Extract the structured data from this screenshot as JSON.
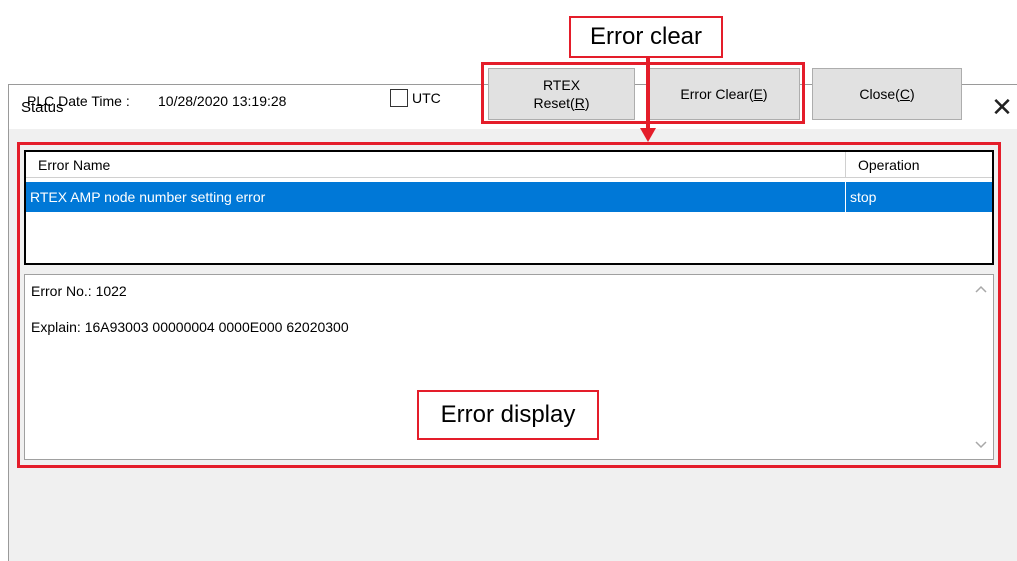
{
  "window": {
    "title": "Status",
    "close_glyph": "✕"
  },
  "plc": {
    "label": "PLC Date Time :",
    "value": "10/28/2020 13:19:28"
  },
  "utc": {
    "label": "UTC",
    "checked": false
  },
  "buttons": {
    "rtex_reset": {
      "line1": "RTEX",
      "line2_prefix": "Reset(",
      "accelerator": "R",
      "line2_suffix": ")"
    },
    "error_clear": {
      "prefix": "Error Clear(",
      "accelerator": "E",
      "suffix": ")"
    },
    "close": {
      "prefix": "Close(",
      "accelerator": "C",
      "suffix": ")"
    }
  },
  "error_table": {
    "columns": [
      "Error Name",
      "Operation"
    ],
    "rows": [
      {
        "name": "RTEX AMP node number setting error",
        "operation": "stop",
        "selected": true
      }
    ]
  },
  "detail": {
    "error_no_label": "Error No.:",
    "error_no_value": "1022",
    "explain_label": "Explain:",
    "explain_value": "16A93003 00000004 0000E000 62020300"
  },
  "callouts": {
    "error_clear": "Error clear",
    "error_display": "Error display"
  },
  "colors": {
    "highlight": "#e41d2a",
    "selection": "#0078d7"
  },
  "icons": {
    "close": "close-icon",
    "scroll_up": "chevron-up-icon",
    "scroll_down": "chevron-down-icon"
  }
}
